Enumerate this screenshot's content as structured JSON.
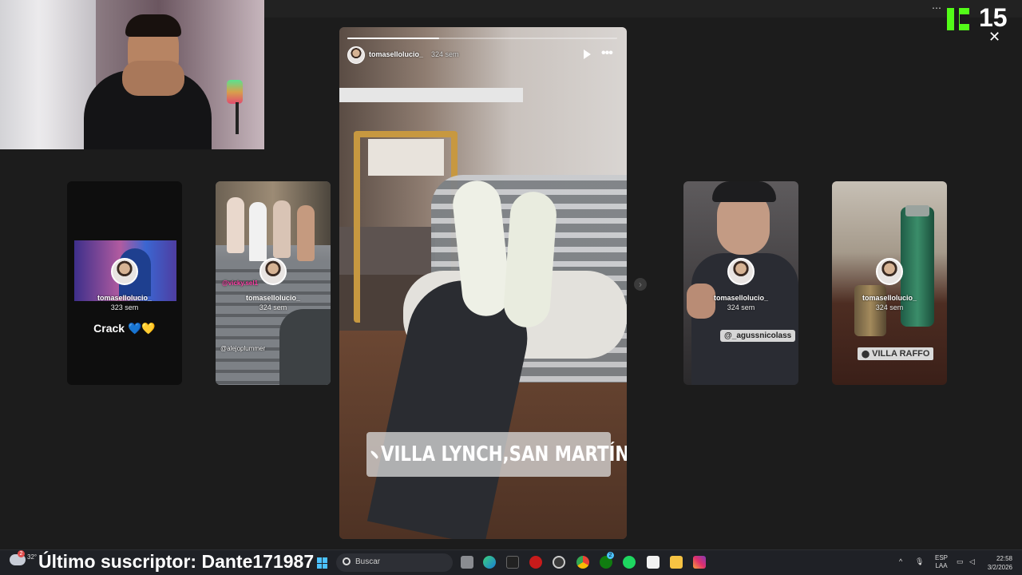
{
  "overlay": {
    "kick_badge_number": "15",
    "subscriber_label": "Último suscriptor: Dante171987"
  },
  "story_viewer": {
    "main": {
      "username": "tomasellolucio_",
      "age": "324 sem",
      "location_sticker": "VILLA LYNCH,SAN MARTÍN.",
      "progress": 0.34
    },
    "thumbnails": [
      {
        "username": "tomasellolucio_",
        "age": "323 sem",
        "caption": "Crack 💙💛"
      },
      {
        "username": "tomasellolucio_",
        "age": "324 sem",
        "mentions": [
          "@vicky.sel1",
          "@alejoplummer"
        ]
      },
      {
        "username": "tomasellolucio_",
        "age": "324 sem",
        "mention": "@_agussnicolass"
      },
      {
        "username": "tomasellolucio_",
        "age": "324 sem",
        "location_sticker": "VILLA RAFFO"
      }
    ]
  },
  "taskbar": {
    "weather_temp": "32°",
    "search_placeholder": "Buscar",
    "language_line1": "ESP",
    "language_line2": "LAA",
    "time": "22:58",
    "date": "3/2/2026",
    "notification_badge": "2",
    "xbox_badge": "2"
  },
  "colors": {
    "background": "#1c1c1c",
    "kick_green": "#53fc18",
    "taskbar": "#1f2126"
  },
  "icons": {
    "play": "play-icon",
    "more": "more-options-icon",
    "close": "close-icon",
    "next": "chevron-right-icon",
    "windows": "windows-start-icon",
    "search": "search-icon"
  }
}
